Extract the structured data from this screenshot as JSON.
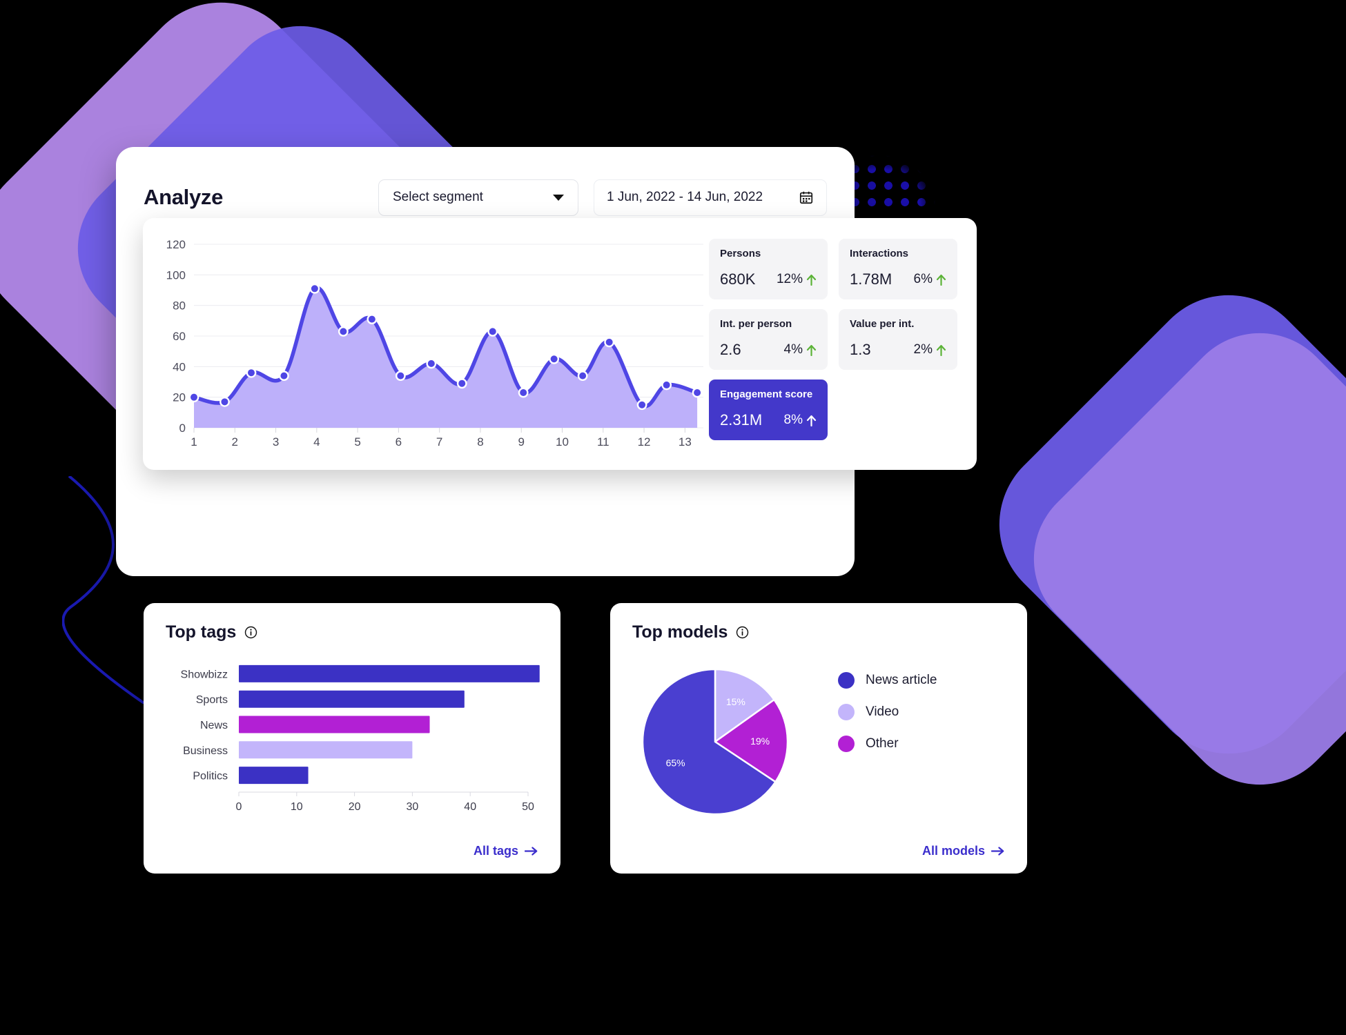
{
  "header": {
    "title": "Analyze",
    "segment_label": "Select segment",
    "date_range": "1 Jun, 2022 - 14 Jun, 2022",
    "calendar_icon": "calendar-icon",
    "caret_icon": "chevron-down-icon"
  },
  "kpis": [
    {
      "title": "Persons",
      "value": "680K",
      "delta": "12%",
      "trend": "up",
      "accent": false
    },
    {
      "title": "Interactions",
      "value": "1.78M",
      "delta": "6%",
      "trend": "up",
      "accent": false
    },
    {
      "title": "Int. per person",
      "value": "2.6",
      "delta": "4%",
      "trend": "up",
      "accent": false
    },
    {
      "title": "Value per int.",
      "value": "1.3",
      "delta": "2%",
      "trend": "up",
      "accent": false
    },
    {
      "title": "Engagement score",
      "value": "2.31M",
      "delta": "8%",
      "trend": "up",
      "accent": true
    }
  ],
  "tags_card": {
    "title": "Top tags",
    "info_icon": "info-icon",
    "link_label": "All tags",
    "link_icon": "arrow-right-icon"
  },
  "models_card": {
    "title": "Top models",
    "info_icon": "info-icon",
    "link_label": "All models",
    "link_icon": "arrow-right-icon",
    "legend": [
      {
        "label": "News article",
        "color": "#3b31c4"
      },
      {
        "label": "Video",
        "color": "#c3b5fb"
      },
      {
        "label": "Other",
        "color": "#b220d4"
      }
    ]
  },
  "colors": {
    "line": "#4f46e5",
    "area": "#bdb0fa",
    "accent_card": "#4338ca",
    "trend_up": "#5cb338",
    "link": "#3b2ecc"
  },
  "chart_data": [
    {
      "type": "area",
      "title": "",
      "xlabel": "",
      "ylabel": "",
      "x": [
        1,
        1.35,
        1.7,
        2.1,
        2.45,
        2.85,
        3.25,
        3.6,
        4,
        4.4,
        4.8,
        5.2,
        5.6,
        6,
        6.4,
        6.8,
        7.2,
        7.6,
        8,
        8.4,
        8.8,
        9.2,
        9.6,
        10,
        10.4,
        10.8,
        11.2,
        11.6,
        12,
        12.4,
        12.8,
        13.2
      ],
      "xtick_labels": [
        "1",
        "2",
        "3",
        "4",
        "5",
        "6",
        "7",
        "8",
        "9",
        "10",
        "11",
        "12",
        "13"
      ],
      "ytick_labels": [
        "0",
        "20",
        "40",
        "60",
        "80",
        "100",
        "120"
      ],
      "ylim": [
        0,
        120
      ],
      "grid": true,
      "values": [
        20,
        17,
        36,
        34,
        91,
        63,
        71,
        34,
        42,
        29,
        63,
        23,
        45,
        34,
        56,
        15,
        28,
        23
      ],
      "points": [
        {
          "x": 1.0,
          "y": 20
        },
        {
          "x": 1.75,
          "y": 17
        },
        {
          "x": 2.4,
          "y": 36
        },
        {
          "x": 3.2,
          "y": 34
        },
        {
          "x": 3.95,
          "y": 91
        },
        {
          "x": 4.65,
          "y": 63
        },
        {
          "x": 5.35,
          "y": 71
        },
        {
          "x": 6.05,
          "y": 34
        },
        {
          "x": 6.8,
          "y": 42
        },
        {
          "x": 7.55,
          "y": 29
        },
        {
          "x": 8.3,
          "y": 63
        },
        {
          "x": 9.05,
          "y": 23
        },
        {
          "x": 9.8,
          "y": 45
        },
        {
          "x": 10.5,
          "y": 34
        },
        {
          "x": 11.15,
          "y": 56
        },
        {
          "x": 11.95,
          "y": 15
        },
        {
          "x": 12.55,
          "y": 28
        },
        {
          "x": 13.3,
          "y": 23
        }
      ]
    },
    {
      "type": "bar",
      "orientation": "horizontal",
      "title": "Top tags",
      "categories": [
        "Showbizz",
        "Sports",
        "News",
        "Business",
        "Politics"
      ],
      "values": [
        52,
        39,
        33,
        30,
        12
      ],
      "colors": [
        "#3b31c4",
        "#3b31c4",
        "#b220d4",
        "#c3b5fb",
        "#3b31c4"
      ],
      "xtick_labels": [
        "0",
        "10",
        "20",
        "30",
        "40",
        "50"
      ],
      "xlim": [
        0,
        50
      ],
      "grid": false
    },
    {
      "type": "pie",
      "title": "Top models",
      "labels": [
        "News article",
        "Video",
        "Other"
      ],
      "values": [
        65,
        15,
        19
      ],
      "display_values": [
        "65%",
        "15%",
        "19%"
      ],
      "colors": [
        "#4a3fd0",
        "#c3b5fb",
        "#b220d4"
      ],
      "legend_position": "right"
    }
  ]
}
